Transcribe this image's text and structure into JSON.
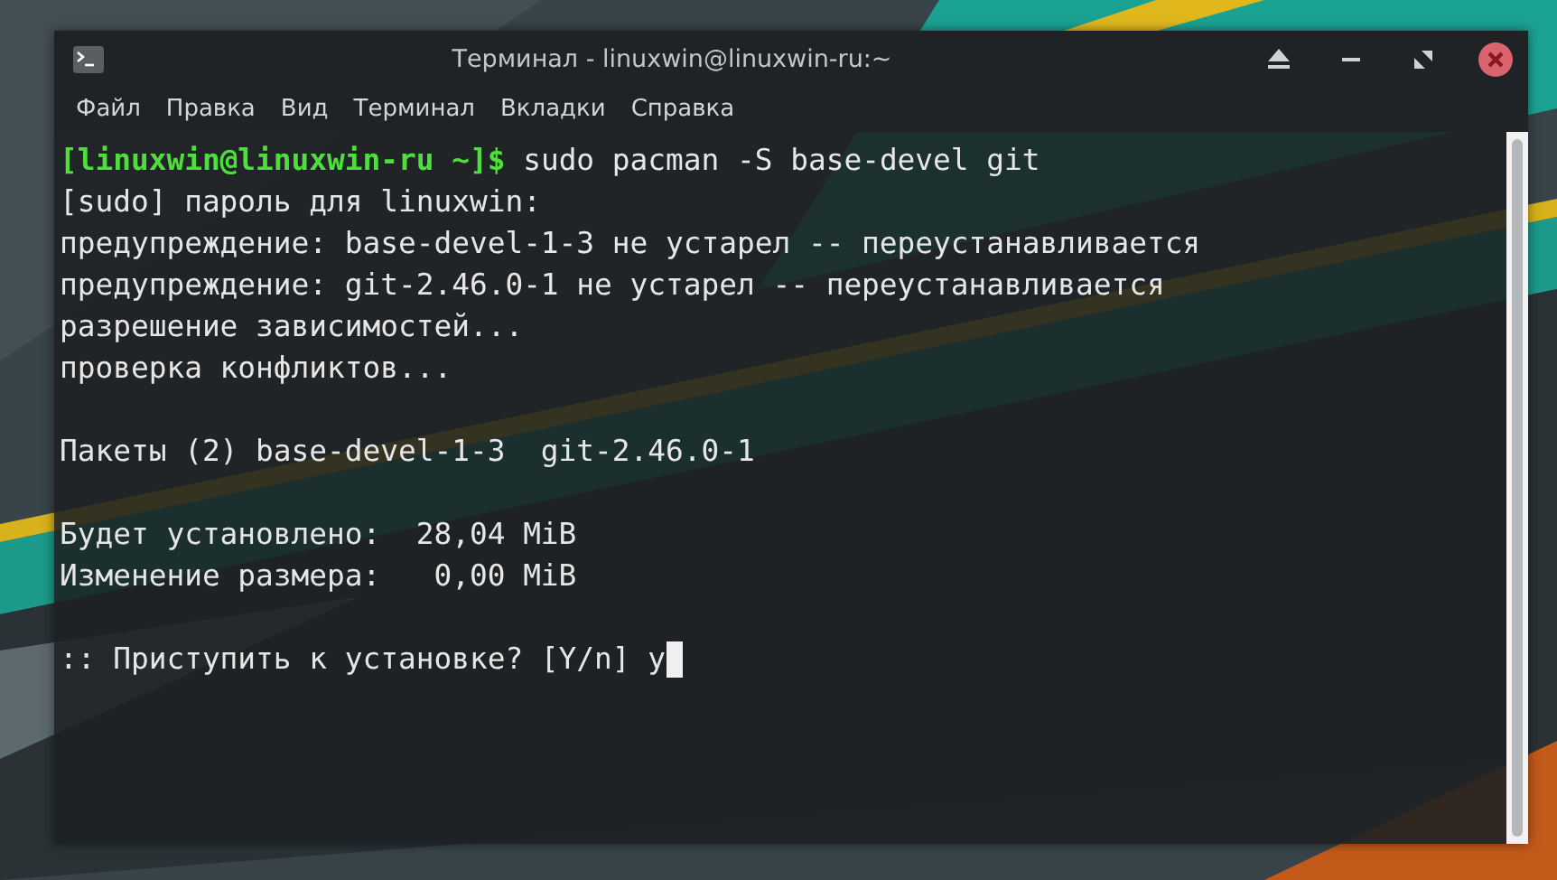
{
  "window": {
    "title": "Терминал - linuxwin@linuxwin-ru:~"
  },
  "menu": [
    {
      "label": "Файл"
    },
    {
      "label": "Правка"
    },
    {
      "label": "Вид"
    },
    {
      "label": "Терминал"
    },
    {
      "label": "Вкладки"
    },
    {
      "label": "Справка"
    }
  ],
  "terminal": {
    "lines": [
      {
        "kind": "prompt",
        "prompt": "[linuxwin@linuxwin-ru ~]$",
        "command": "sudo pacman -S base-devel git"
      },
      {
        "kind": "output",
        "text": "[sudo] пароль для linuxwin:"
      },
      {
        "kind": "output",
        "text": "предупреждение: base-devel-1-3 не устарел -- переустанавливается"
      },
      {
        "kind": "output",
        "text": "предупреждение: git-2.46.0-1 не устарел -- переустанавливается"
      },
      {
        "kind": "output",
        "text": "разрешение зависимостей..."
      },
      {
        "kind": "output",
        "text": "проверка конфликтов..."
      },
      {
        "kind": "blank"
      },
      {
        "kind": "output",
        "text": "Пакеты (2) base-devel-1-3  git-2.46.0-1"
      },
      {
        "kind": "blank"
      },
      {
        "kind": "output",
        "text": "Будет установлено:  28,04 MiB"
      },
      {
        "kind": "output",
        "text": "Изменение размера:   0,00 MiB"
      },
      {
        "kind": "blank"
      },
      {
        "kind": "input",
        "text": ":: Приступить к установке? [Y/n] y",
        "cursor": true
      }
    ]
  }
}
